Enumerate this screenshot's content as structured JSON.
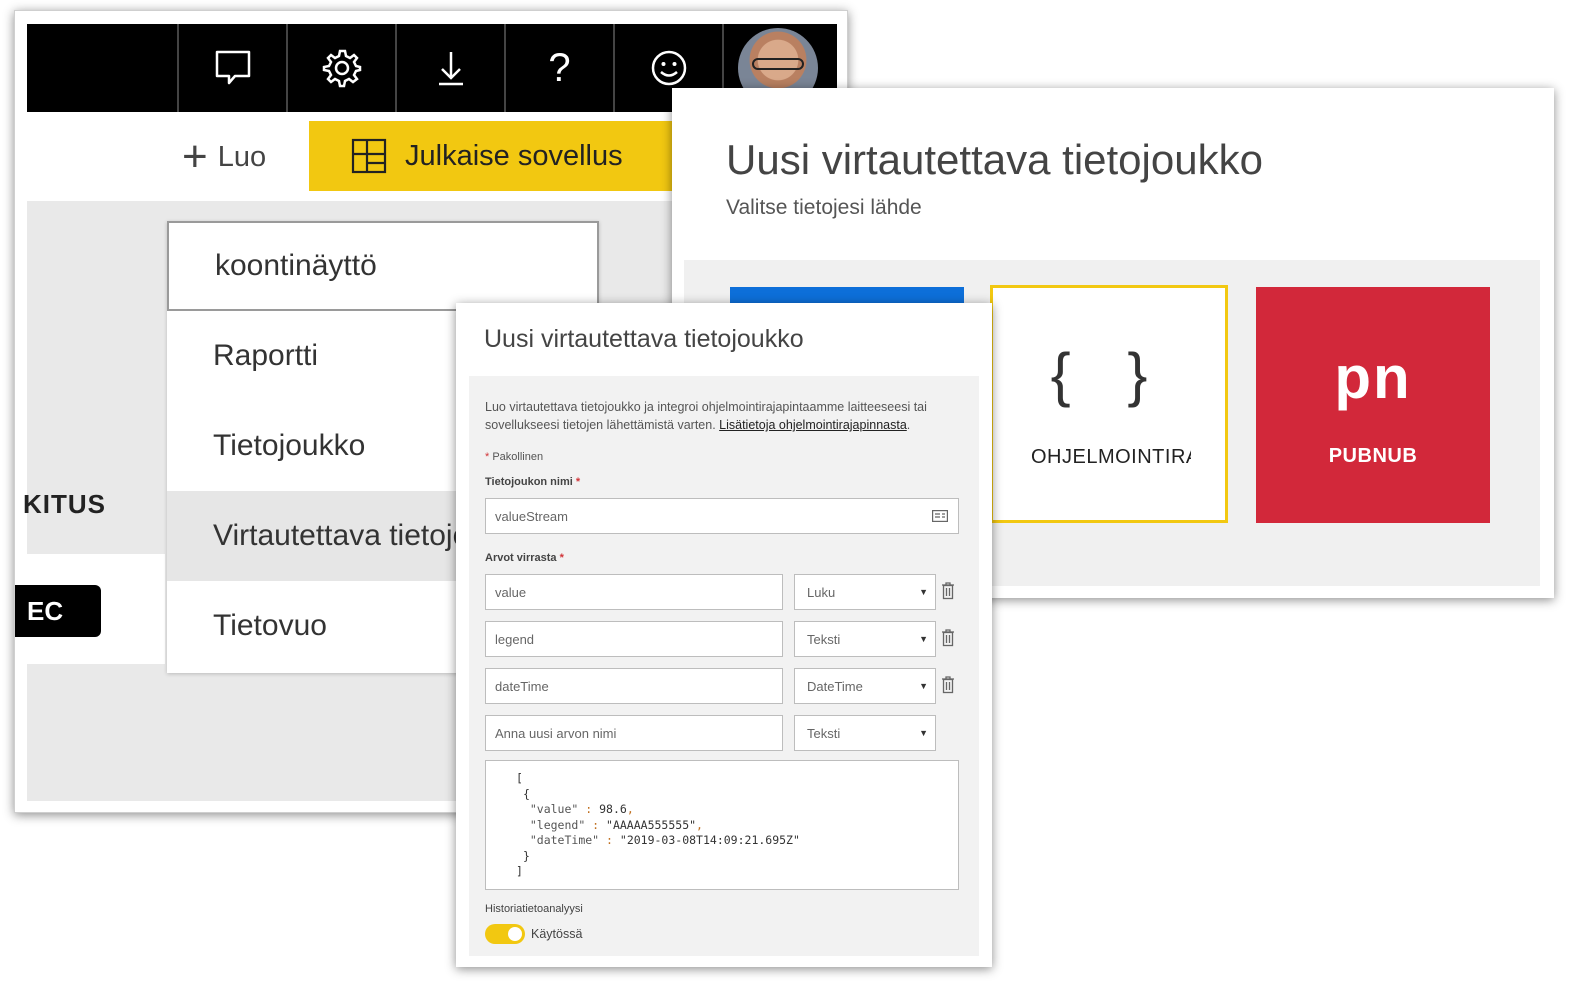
{
  "background_window": {
    "toolbar": {
      "icons": [
        "comment-icon",
        "gear-icon",
        "download-icon",
        "help-icon",
        "smiley-icon"
      ],
      "help_glyph": "?"
    },
    "actions": {
      "create_label": "Luo",
      "publish_label": "Julkaise sovellus"
    },
    "left_fragments": {
      "heading_fragment": "KITUS",
      "button_fragment": "EC"
    },
    "create_menu": {
      "items": [
        "koontinäyttö",
        "Raportti",
        "Tietojoukko",
        "Virtautettava tietojoukko",
        "Tietovuo"
      ],
      "selected_index": 3
    }
  },
  "source_dialog": {
    "title": "Uusi virtautettava tietojoukko",
    "subtitle": "Valitse tietojesi lähde",
    "tiles": {
      "api_glyph": "{ }",
      "api_label": "OHJELMOINTIRAJAPINTA",
      "pubnub_glyph": "pn",
      "pubnub_label": "PUBNUB"
    },
    "colors": {
      "blue_tile": "#0d6fd9",
      "accent": "#f2c811",
      "pubnub": "#d2283a"
    }
  },
  "form_dialog": {
    "title": "Uusi virtautettava tietojoukko",
    "description": "Luo virtautettava tietojoukko ja integroi ohjelmointirajapintaamme laitteeseesi tai sovellukseesi tietojen lähettämistä varten. ",
    "learn_more_link": "Lisätietoja ohjelmointirajapinnasta",
    "description_end": ".",
    "required_note": "Pakollinen",
    "dataset_name_label": "Tietojoukon nimi",
    "dataset_name_value": "valueStream",
    "values_label": "Arvot virrasta",
    "value_rows": [
      {
        "name": "value",
        "type": "Luku"
      },
      {
        "name": "legend",
        "type": "Teksti"
      },
      {
        "name": "dateTime",
        "type": "DateTime"
      }
    ],
    "new_value_placeholder": "Anna uusi arvon nimi",
    "new_value_type": "Teksti",
    "json_sample": {
      "open": "[",
      "obj_open": "{",
      "lines": [
        {
          "key": "\"value\"",
          "sep": " : ",
          "val": "98.6",
          "end": ","
        },
        {
          "key": "\"legend\"",
          "sep": " : ",
          "val": "\"AAAAA555555\"",
          "end": ","
        },
        {
          "key": "\"dateTime\"",
          "sep": " : ",
          "val": "\"2019-03-08T14:09:21.695Z\"",
          "end": ""
        }
      ],
      "obj_close": "}",
      "close": "]"
    },
    "history_label": "Historiatietoanalyysi",
    "history_toggle_label": "Käytössä",
    "history_enabled": true
  }
}
